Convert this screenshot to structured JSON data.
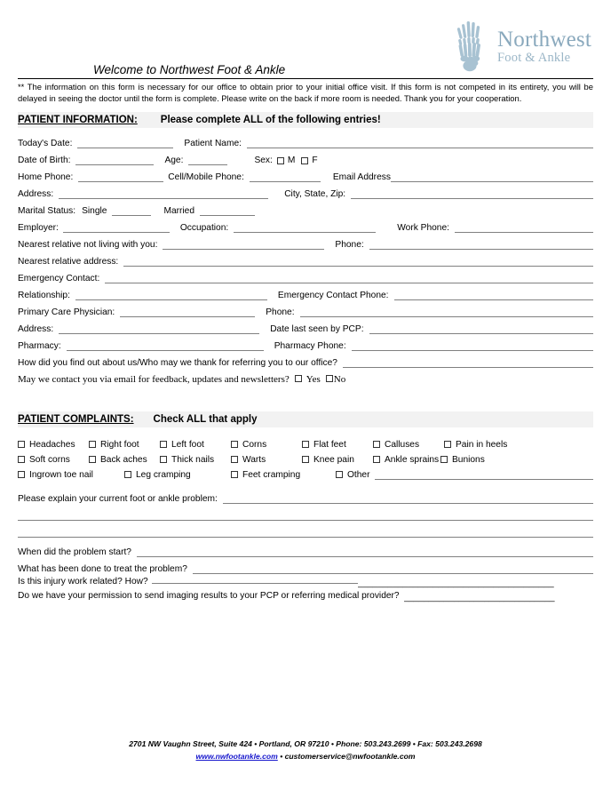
{
  "logo": {
    "icon": "foot-skeleton-xray-icon",
    "name": "Northwest",
    "sub": "Foot & Ankle",
    "color": "#8aa9bd"
  },
  "welcome": "Welcome to Northwest Foot & Ankle",
  "disclaimer": "** The information on this form is necessary for our office to obtain prior to your initial office visit.  If this form is not competed in its entirety, you will be delayed in seeing the doctor until the form is complete.   Please write on the back if more room is needed.   Thank you for your cooperation.",
  "patient_information": {
    "title": "PATIENT INFORMATION:",
    "subtitle": "Please complete ALL of the following entries!",
    "labels": {
      "todays_date": "Today's Date:",
      "patient_name": "Patient Name:",
      "date_of_birth": "Date of Birth:",
      "age": "Age:",
      "sex": "Sex:",
      "sex_male": "M",
      "sex_female": "F",
      "home_phone": "Home Phone:",
      "cell_phone": "Cell/Mobile Phone:",
      "email_address": "Email Address",
      "address": "Address:",
      "city_state_zip": "City, State, Zip:",
      "marital_status": "Marital Status:",
      "single": "Single",
      "married": "Married",
      "employer": "Employer:",
      "occupation": "Occupation:",
      "work_phone": "Work Phone:",
      "nearest_relative": "Nearest relative not living with you:",
      "phone": "Phone:",
      "nearest_relative_address": "Nearest relative address:",
      "emergency_contact": "Emergency Contact:",
      "relationship": "Relationship:",
      "emergency_contact_phone": "Emergency Contact Phone:",
      "primary_care_physician": "Primary Care Physician:",
      "pcp_phone": "Phone:",
      "pcp_address": "Address:",
      "date_last_seen": "Date last seen by PCP:",
      "pharmacy": "Pharmacy:",
      "pharmacy_phone": "Pharmacy Phone:",
      "referral": "How did you find out about us/Who may we thank for referring you to our office?",
      "email_consent": "May we contact you via email for feedback, updates and newsletters?",
      "yes": "Yes",
      "no": "No"
    }
  },
  "patient_complaints": {
    "title": "PATIENT COMPLAINTS:",
    "subtitle": "Check ALL that apply",
    "row1": [
      "Headaches",
      "Right foot",
      "Left foot",
      "Corns",
      "Flat feet",
      "Calluses",
      "Pain in heels"
    ],
    "row2": [
      "Soft corns",
      "Back aches",
      "Thick nails",
      "Warts",
      "Knee pain",
      "Ankle sprains",
      "Bunions"
    ],
    "row3": [
      "Ingrown toe nail",
      "Leg cramping",
      "Feet cramping",
      "Other"
    ],
    "questions": {
      "explain": "Please explain your current foot or ankle problem:",
      "when_start": "When did the problem start?",
      "what_done": "What has been done to treat the problem?",
      "work_related": "Is this injury work related? How?",
      "work_related_line": "_______________________________________",
      "imaging_permission": "Do we have your permission to send imaging results to your PCP or referring medical provider?",
      "imaging_permission_line": "______________________________"
    }
  },
  "footer": {
    "line1": "2701 NW Vaughn Street, Suite 424 • Portland, OR 97210 •  Phone:  503.243.2699  •  Fax: 503.243.2698",
    "url": "www.nwfootankle.com",
    "sep": " • ",
    "email": "customerservice@nwfootankle.com"
  }
}
